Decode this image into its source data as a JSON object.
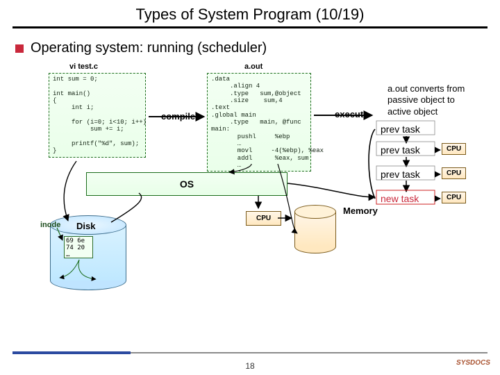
{
  "title": "Types of System Program (10/19)",
  "subheading": "Operating system: running (scheduler)",
  "source": {
    "label": "vi test.c",
    "code": "int sum = 0;\n\nint main()\n{\n     int i;\n\n     for (i=0; i<10; i++)\n          sum += i;\n\n     printf(\"%d\", sum);\n}"
  },
  "compile_label": "compile",
  "assembly": {
    "label": "a.out",
    "code": ".data\n     .align 4\n     .type   sum,@object\n     .size    sum,4\n.text\n.global main\n     .type   main, @func\nmain:\n       pushl     %ebp\n       …\n       movl     -4(%ebp), %eax\n       addl      %eax, sum\n       …"
  },
  "execute_label": "execute",
  "note_lines": {
    "l1": "a.out converts from",
    "l2": "passive object to",
    "l3": "active object"
  },
  "tasks": {
    "prev1": "prev task",
    "prev2": "prev task",
    "prev3": "prev task",
    "new": "new  task"
  },
  "os_label": "OS",
  "cpu_label": "CPU",
  "memory_label": "Memory",
  "disk": {
    "label": "Disk",
    "inode": "inode",
    "hex": "69 6e\n74 20\n…"
  },
  "page_number": "18",
  "logo_text": "SYSDOCS"
}
